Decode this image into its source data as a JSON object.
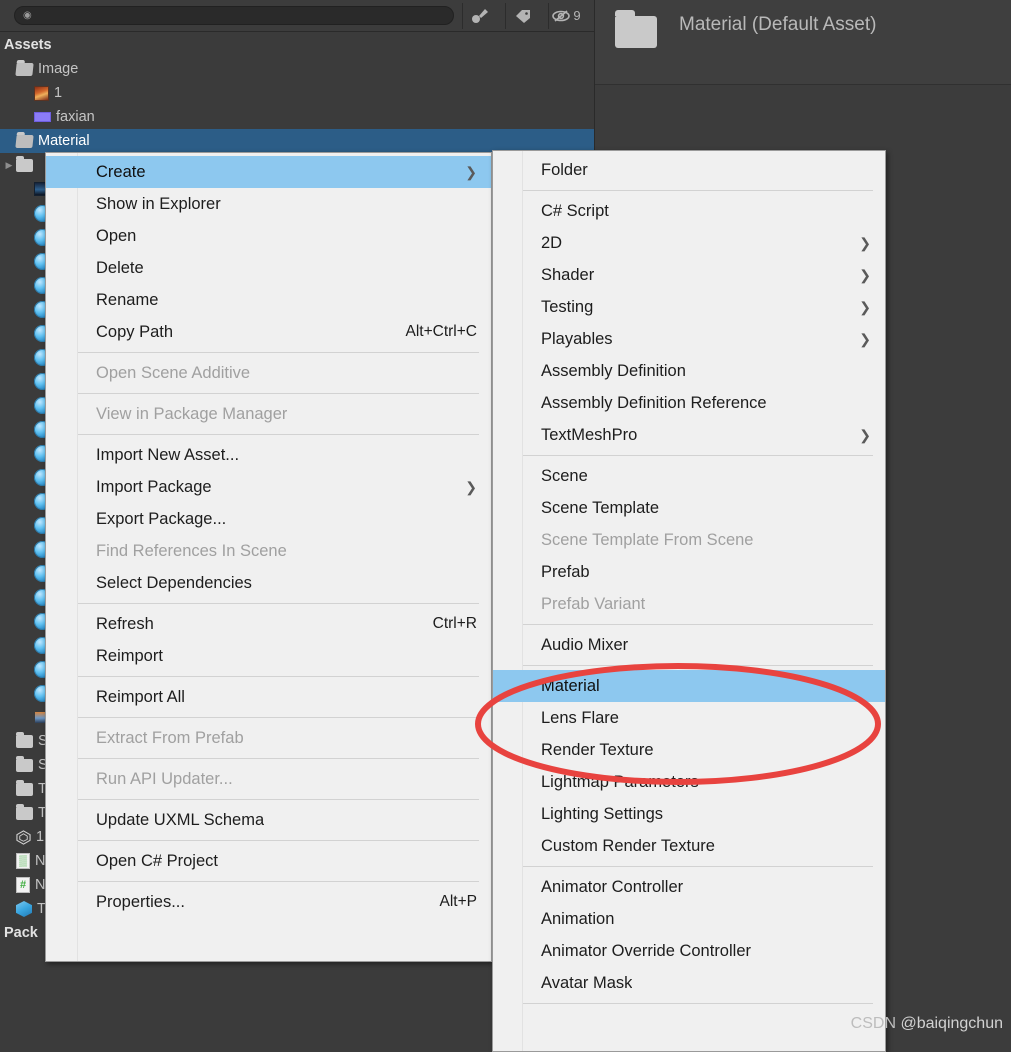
{
  "window": {
    "background_color": "#383838",
    "panel_color": "#3b3b3b"
  },
  "project_panel": {
    "toolbar": {
      "search_icon": "search-icon",
      "search_value": "",
      "search_placeholder": "",
      "filters": [
        {
          "name": "type-filter-icon",
          "label": ""
        },
        {
          "name": "label-filter-icon",
          "label": ""
        },
        {
          "name": "saved-search-icon",
          "label": "9"
        }
      ]
    },
    "tree": [
      {
        "label": "Assets",
        "icon": "",
        "indent": 0,
        "selected": false,
        "header": true,
        "twisty": ""
      },
      {
        "label": "Image",
        "icon": "folder-open-icon",
        "indent": 0,
        "selected": false,
        "header": false,
        "twisty": ""
      },
      {
        "label": "1",
        "icon": "texture-icon",
        "indent": 1,
        "selected": false,
        "header": false,
        "twisty": ""
      },
      {
        "label": "faxian",
        "icon": "material-swatch-icon",
        "indent": 1,
        "selected": false,
        "header": false,
        "twisty": ""
      },
      {
        "label": "Material",
        "icon": "folder-open-icon",
        "indent": 0,
        "selected": true,
        "header": false,
        "twisty": ""
      },
      {
        "label": "",
        "icon": "folder-icon",
        "indent": 0,
        "selected": false,
        "header": false,
        "twisty": "▶"
      },
      {
        "label": "",
        "icon": "image-dark-icon",
        "indent": 1,
        "selected": false,
        "header": false,
        "twisty": ""
      },
      {
        "label": "",
        "icon": "material-icon",
        "indent": 1,
        "selected": false,
        "header": false,
        "twisty": ""
      },
      {
        "label": "",
        "icon": "material-icon",
        "indent": 1,
        "selected": false,
        "header": false,
        "twisty": ""
      },
      {
        "label": "",
        "icon": "material-icon",
        "indent": 1,
        "selected": false,
        "header": false,
        "twisty": ""
      },
      {
        "label": "",
        "icon": "material-icon",
        "indent": 1,
        "selected": false,
        "header": false,
        "twisty": ""
      },
      {
        "label": "",
        "icon": "material-icon",
        "indent": 1,
        "selected": false,
        "header": false,
        "twisty": ""
      },
      {
        "label": "",
        "icon": "material-icon",
        "indent": 1,
        "selected": false,
        "header": false,
        "twisty": ""
      },
      {
        "label": "",
        "icon": "material-icon",
        "indent": 1,
        "selected": false,
        "header": false,
        "twisty": ""
      },
      {
        "label": "",
        "icon": "material-icon",
        "indent": 1,
        "selected": false,
        "header": false,
        "twisty": ""
      },
      {
        "label": "",
        "icon": "material-icon",
        "indent": 1,
        "selected": false,
        "header": false,
        "twisty": ""
      },
      {
        "label": "",
        "icon": "material-icon",
        "indent": 1,
        "selected": false,
        "header": false,
        "twisty": ""
      },
      {
        "label": "",
        "icon": "material-icon",
        "indent": 1,
        "selected": false,
        "header": false,
        "twisty": ""
      },
      {
        "label": "",
        "icon": "material-icon",
        "indent": 1,
        "selected": false,
        "header": false,
        "twisty": ""
      },
      {
        "label": "",
        "icon": "material-icon",
        "indent": 1,
        "selected": false,
        "header": false,
        "twisty": ""
      },
      {
        "label": "",
        "icon": "material-icon",
        "indent": 1,
        "selected": false,
        "header": false,
        "twisty": ""
      },
      {
        "label": "",
        "icon": "material-icon",
        "indent": 1,
        "selected": false,
        "header": false,
        "twisty": ""
      },
      {
        "label": "",
        "icon": "material-icon",
        "indent": 1,
        "selected": false,
        "header": false,
        "twisty": ""
      },
      {
        "label": "",
        "icon": "material-icon",
        "indent": 1,
        "selected": false,
        "header": false,
        "twisty": ""
      },
      {
        "label": "",
        "icon": "material-icon",
        "indent": 1,
        "selected": false,
        "header": false,
        "twisty": ""
      },
      {
        "label": "",
        "icon": "material-icon",
        "indent": 1,
        "selected": false,
        "header": false,
        "twisty": ""
      },
      {
        "label": "",
        "icon": "material-icon",
        "indent": 1,
        "selected": false,
        "header": false,
        "twisty": ""
      },
      {
        "label": "",
        "icon": "material-icon",
        "indent": 1,
        "selected": false,
        "header": false,
        "twisty": ""
      },
      {
        "label": "",
        "icon": "people-texture-icon",
        "indent": 1,
        "selected": false,
        "header": false,
        "twisty": ""
      },
      {
        "label": "Sc",
        "icon": "folder-icon",
        "indent": 0,
        "selected": false,
        "header": false,
        "twisty": ""
      },
      {
        "label": "Sh",
        "icon": "folder-icon",
        "indent": 0,
        "selected": false,
        "header": false,
        "twisty": ""
      },
      {
        "label": "Te",
        "icon": "folder-icon",
        "indent": 0,
        "selected": false,
        "header": false,
        "twisty": ""
      },
      {
        "label": "Tre",
        "icon": "folder-icon",
        "indent": 0,
        "selected": false,
        "header": false,
        "twisty": ""
      },
      {
        "label": "1",
        "icon": "unity-scene-icon",
        "indent": 0,
        "selected": false,
        "header": false,
        "twisty": ""
      },
      {
        "label": "Ne",
        "icon": "shader-file-icon",
        "indent": 0,
        "selected": false,
        "header": false,
        "twisty": ""
      },
      {
        "label": "Ne",
        "icon": "csharp-script-icon",
        "indent": 0,
        "selected": false,
        "header": false,
        "twisty": ""
      },
      {
        "label": "Tre",
        "icon": "prefab-icon",
        "indent": 0,
        "selected": false,
        "header": false,
        "twisty": ""
      },
      {
        "label": "Pack",
        "icon": "",
        "indent": 0,
        "selected": false,
        "header": true,
        "twisty": ""
      }
    ]
  },
  "inspector": {
    "icon": "folder-icon",
    "title": "Material (Default Asset)"
  },
  "context_menu": {
    "name": "asset-context-menu",
    "items": [
      {
        "label": "Create",
        "shortcut": "",
        "submenu": true,
        "disabled": false,
        "highlight": true
      },
      {
        "label": "Show in Explorer",
        "shortcut": "",
        "submenu": false,
        "disabled": false,
        "highlight": false
      },
      {
        "label": "Open",
        "shortcut": "",
        "submenu": false,
        "disabled": false,
        "highlight": false
      },
      {
        "label": "Delete",
        "shortcut": "",
        "submenu": false,
        "disabled": false,
        "highlight": false
      },
      {
        "label": "Rename",
        "shortcut": "",
        "submenu": false,
        "disabled": false,
        "highlight": false
      },
      {
        "label": "Copy Path",
        "shortcut": "Alt+Ctrl+C",
        "submenu": false,
        "disabled": false,
        "highlight": false
      },
      {
        "separator": true
      },
      {
        "label": "Open Scene Additive",
        "shortcut": "",
        "submenu": false,
        "disabled": true,
        "highlight": false
      },
      {
        "separator": true
      },
      {
        "label": "View in Package Manager",
        "shortcut": "",
        "submenu": false,
        "disabled": true,
        "highlight": false
      },
      {
        "separator": true
      },
      {
        "label": "Import New Asset...",
        "shortcut": "",
        "submenu": false,
        "disabled": false,
        "highlight": false
      },
      {
        "label": "Import Package",
        "shortcut": "",
        "submenu": true,
        "disabled": false,
        "highlight": false
      },
      {
        "label": "Export Package...",
        "shortcut": "",
        "submenu": false,
        "disabled": false,
        "highlight": false
      },
      {
        "label": "Find References In Scene",
        "shortcut": "",
        "submenu": false,
        "disabled": true,
        "highlight": false
      },
      {
        "label": "Select Dependencies",
        "shortcut": "",
        "submenu": false,
        "disabled": false,
        "highlight": false
      },
      {
        "separator": true
      },
      {
        "label": "Refresh",
        "shortcut": "Ctrl+R",
        "submenu": false,
        "disabled": false,
        "highlight": false
      },
      {
        "label": "Reimport",
        "shortcut": "",
        "submenu": false,
        "disabled": false,
        "highlight": false
      },
      {
        "separator": true
      },
      {
        "label": "Reimport All",
        "shortcut": "",
        "submenu": false,
        "disabled": false,
        "highlight": false
      },
      {
        "separator": true
      },
      {
        "label": "Extract From Prefab",
        "shortcut": "",
        "submenu": false,
        "disabled": true,
        "highlight": false
      },
      {
        "separator": true
      },
      {
        "label": "Run API Updater...",
        "shortcut": "",
        "submenu": false,
        "disabled": true,
        "highlight": false
      },
      {
        "separator": true
      },
      {
        "label": "Update UXML Schema",
        "shortcut": "",
        "submenu": false,
        "disabled": false,
        "highlight": false
      },
      {
        "separator": true
      },
      {
        "label": "Open C# Project",
        "shortcut": "",
        "submenu": false,
        "disabled": false,
        "highlight": false
      },
      {
        "separator": true
      },
      {
        "label": "Properties...",
        "shortcut": "Alt+P",
        "submenu": false,
        "disabled": false,
        "highlight": false
      }
    ]
  },
  "create_submenu": {
    "name": "create-submenu",
    "items": [
      {
        "label": "Folder",
        "submenu": false,
        "disabled": false,
        "highlight": false
      },
      {
        "separator": true
      },
      {
        "label": "C# Script",
        "submenu": false,
        "disabled": false,
        "highlight": false
      },
      {
        "label": "2D",
        "submenu": true,
        "disabled": false,
        "highlight": false
      },
      {
        "label": "Shader",
        "submenu": true,
        "disabled": false,
        "highlight": false
      },
      {
        "label": "Testing",
        "submenu": true,
        "disabled": false,
        "highlight": false
      },
      {
        "label": "Playables",
        "submenu": true,
        "disabled": false,
        "highlight": false
      },
      {
        "label": "Assembly Definition",
        "submenu": false,
        "disabled": false,
        "highlight": false
      },
      {
        "label": "Assembly Definition Reference",
        "submenu": false,
        "disabled": false,
        "highlight": false
      },
      {
        "label": "TextMeshPro",
        "submenu": true,
        "disabled": false,
        "highlight": false
      },
      {
        "separator": true
      },
      {
        "label": "Scene",
        "submenu": false,
        "disabled": false,
        "highlight": false
      },
      {
        "label": "Scene Template",
        "submenu": false,
        "disabled": false,
        "highlight": false
      },
      {
        "label": "Scene Template From Scene",
        "submenu": false,
        "disabled": true,
        "highlight": false
      },
      {
        "label": "Prefab",
        "submenu": false,
        "disabled": false,
        "highlight": false
      },
      {
        "label": "Prefab Variant",
        "submenu": false,
        "disabled": true,
        "highlight": false
      },
      {
        "separator": true
      },
      {
        "label": "Audio Mixer",
        "submenu": false,
        "disabled": false,
        "highlight": false
      },
      {
        "separator": true
      },
      {
        "label": "Material",
        "submenu": false,
        "disabled": false,
        "highlight": true
      },
      {
        "label": "Lens Flare",
        "submenu": false,
        "disabled": false,
        "highlight": false
      },
      {
        "label": "Render Texture",
        "submenu": false,
        "disabled": false,
        "highlight": false
      },
      {
        "label": "Lightmap Parameters",
        "submenu": false,
        "disabled": false,
        "highlight": false
      },
      {
        "label": "Lighting Settings",
        "submenu": false,
        "disabled": false,
        "highlight": false
      },
      {
        "label": "Custom Render Texture",
        "submenu": false,
        "disabled": false,
        "highlight": false
      },
      {
        "separator": true
      },
      {
        "label": "Animator Controller",
        "submenu": false,
        "disabled": false,
        "highlight": false
      },
      {
        "label": "Animation",
        "submenu": false,
        "disabled": false,
        "highlight": false
      },
      {
        "label": "Animator Override Controller",
        "submenu": false,
        "disabled": false,
        "highlight": false
      },
      {
        "label": "Avatar Mask",
        "submenu": false,
        "disabled": false,
        "highlight": false
      },
      {
        "separator": true
      }
    ]
  },
  "annotation": {
    "name": "red-ellipse-highlight",
    "color": "#E8433F",
    "stroke_width": 6
  },
  "watermark": {
    "prefix": "CSDN ",
    "handle": "@baiqingchun"
  }
}
